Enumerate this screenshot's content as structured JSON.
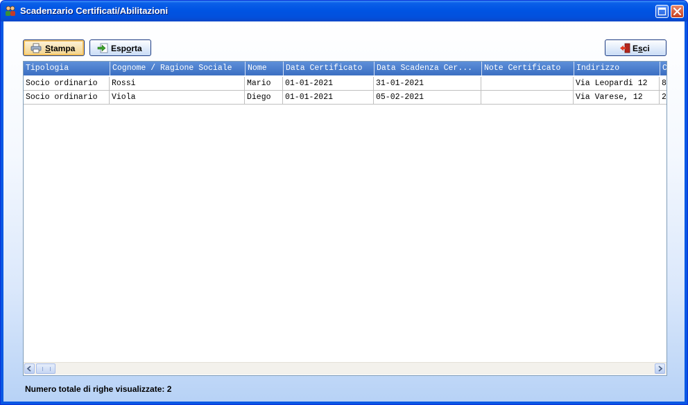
{
  "window": {
    "title": "Scadenzario Certificati/Abilitazioni",
    "app_icon": "people-icon",
    "controls": [
      "maximize-icon",
      "close-icon"
    ]
  },
  "toolbar": {
    "stampa": {
      "label_pre": "",
      "label_ul": "S",
      "label_post": "tampa",
      "icon": "printer-icon"
    },
    "esporta": {
      "label_pre": "Esp",
      "label_ul": "o",
      "label_post": "rta",
      "icon": "export-icon"
    },
    "esci": {
      "label_pre": "E",
      "label_ul": "s",
      "label_post": "ci",
      "icon": "exit-door-icon"
    }
  },
  "grid": {
    "columns": [
      "Tipologia",
      "Cognome / Ragione Sociale",
      "Nome",
      "Data Certificato",
      "Data Scadenza Cer...",
      "Note Certificato",
      "Indirizzo",
      "C"
    ],
    "rows": [
      [
        "Socio ordinario",
        "Rossi",
        "Mario",
        "01-01-2021",
        "31-01-2021",
        "",
        "Via Leopardi 12",
        "8"
      ],
      [
        "Socio ordinario",
        "Viola",
        "Diego",
        "01-01-2021",
        "05-02-2021",
        "",
        "Via Varese, 12",
        "2"
      ]
    ]
  },
  "status": {
    "text": "Numero totale di righe visualizzate: 2"
  },
  "colors": {
    "title_bar": "#0054e3",
    "grid_header": "#4a7fd0",
    "focus_highlight": "#f7c15b"
  }
}
